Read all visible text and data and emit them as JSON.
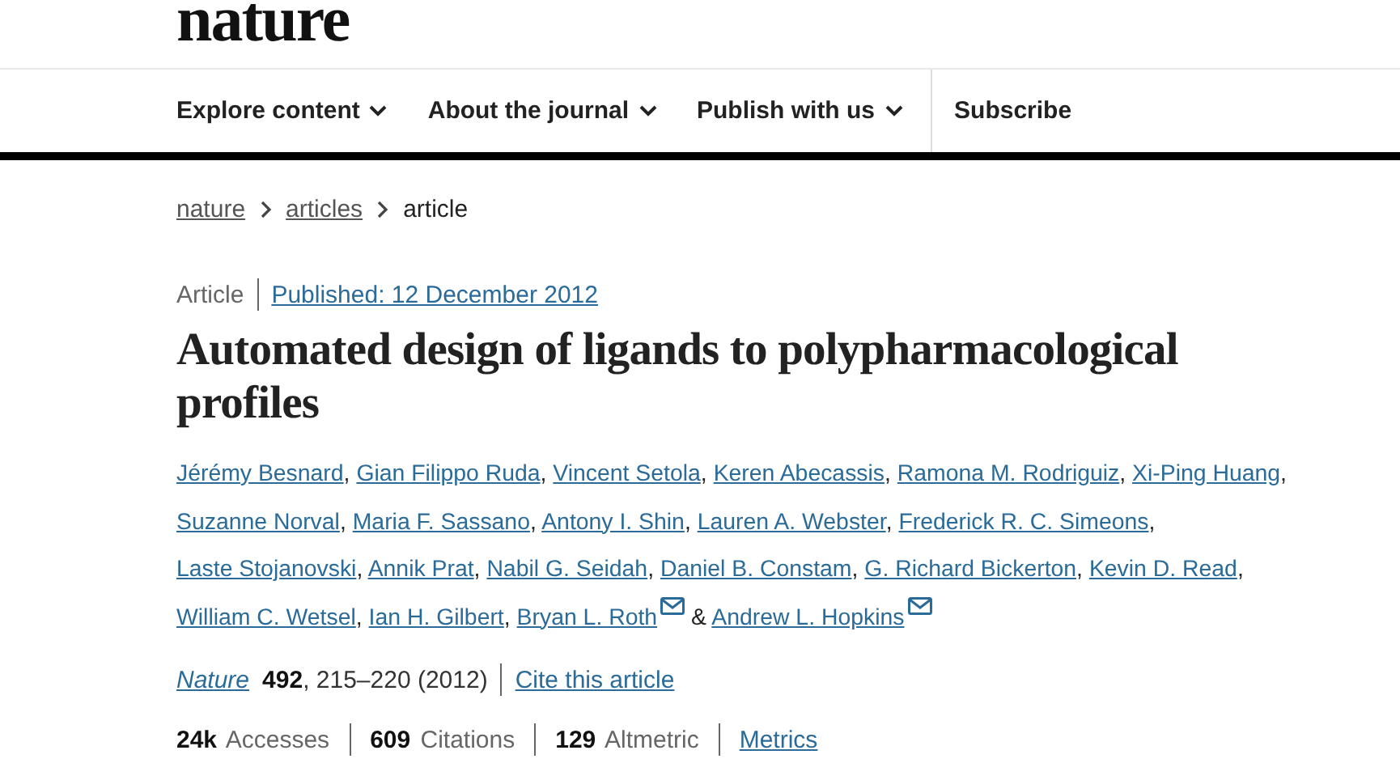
{
  "logo": "nature",
  "nav": [
    {
      "label": "Explore content",
      "dropdown": true
    },
    {
      "label": "About the journal",
      "dropdown": true
    },
    {
      "label": "Publish with us",
      "dropdown": true
    },
    {
      "label": "Subscribe",
      "dropdown": false
    }
  ],
  "breadcrumb": [
    {
      "label": "nature",
      "link": true
    },
    {
      "label": "articles",
      "link": true
    },
    {
      "label": "article",
      "link": false
    }
  ],
  "article_type": "Article",
  "published": "Published: 12 December 2012",
  "title": "Automated design of ligands to polypharmacological profiles",
  "authors": [
    {
      "kind": "author",
      "name": "Jérémy Besnard",
      "suffix": ",",
      "email": false
    },
    {
      "kind": "author",
      "name": "Gian Filippo Ruda",
      "suffix": ",",
      "email": false
    },
    {
      "kind": "author",
      "name": "Vincent Setola",
      "suffix": ",",
      "email": false
    },
    {
      "kind": "author",
      "name": "Keren Abecassis",
      "suffix": ",",
      "email": false
    },
    {
      "kind": "author",
      "name": "Ramona M. Rodriguiz",
      "suffix": ",",
      "email": false
    },
    {
      "kind": "author",
      "name": "Xi-Ping Huang",
      "suffix": ",",
      "email": false
    },
    {
      "kind": "author",
      "name": "Suzanne Norval",
      "suffix": ",",
      "email": false
    },
    {
      "kind": "author",
      "name": "Maria F. Sassano",
      "suffix": ",",
      "email": false
    },
    {
      "kind": "author",
      "name": "Antony I. Shin",
      "suffix": ",",
      "email": false
    },
    {
      "kind": "author",
      "name": "Lauren A. Webster",
      "suffix": ",",
      "email": false
    },
    {
      "kind": "author",
      "name": "Frederick R. C. Simeons",
      "suffix": ",",
      "email": false
    },
    {
      "kind": "author",
      "name": "Laste Stojanovski",
      "suffix": ",",
      "email": false
    },
    {
      "kind": "author",
      "name": "Annik Prat",
      "suffix": ",",
      "email": false
    },
    {
      "kind": "author",
      "name": "Nabil G. Seidah",
      "suffix": ",",
      "email": false
    },
    {
      "kind": "author",
      "name": "Daniel B. Constam",
      "suffix": ",",
      "email": false
    },
    {
      "kind": "author",
      "name": "G. Richard Bickerton",
      "suffix": ",",
      "email": false
    },
    {
      "kind": "author",
      "name": "Kevin D. Read",
      "suffix": ",",
      "email": false
    },
    {
      "kind": "author",
      "name": "William C. Wetsel",
      "suffix": ",",
      "email": false
    },
    {
      "kind": "author",
      "name": "Ian H. Gilbert",
      "suffix": ",",
      "email": false
    },
    {
      "kind": "author",
      "name": "Bryan L. Roth",
      "email": true
    },
    {
      "kind": "joiner",
      "name": "&"
    },
    {
      "kind": "author",
      "name": "Andrew L. Hopkins",
      "email": true
    }
  ],
  "citation": {
    "journal": "Nature",
    "volume": "492",
    "pages": ", 215–220 (2012)",
    "cite_link": "Cite this article"
  },
  "metrics": [
    "**24k** Accesses",
    "**609** Citations",
    "**129** Altmetric"
  ],
  "metrics_link": "Metrics"
}
